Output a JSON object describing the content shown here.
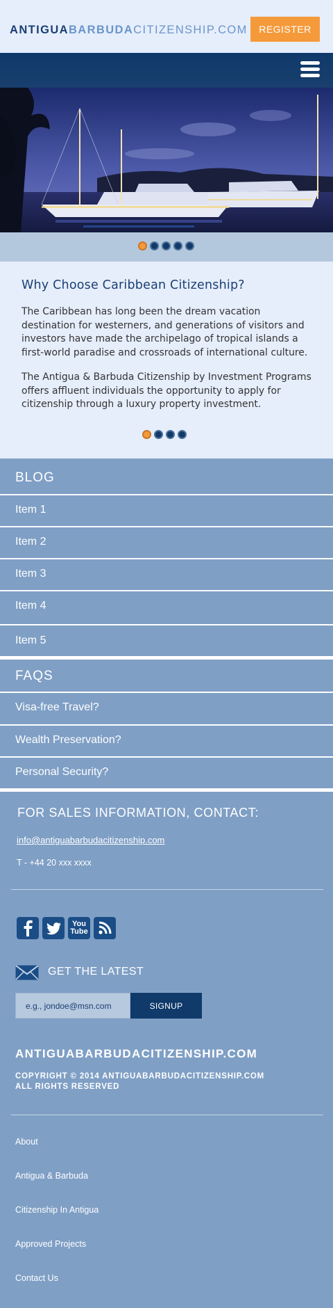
{
  "header": {
    "logo_part1": "ANTIGUA",
    "logo_part2": "BARBUDA",
    "logo_part3": "CITIZENSHIP.COM",
    "register_label": "REGISTER"
  },
  "colors": {
    "header_bg": "#e6eefb",
    "navbar": "#0f3a6a",
    "accent": "#f59a3a",
    "body_bg": "#7f9fc5",
    "heading_blue": "#1b3f73"
  },
  "hero": {
    "image": "superyachts-marina-dusk",
    "slides_count": 5,
    "active_slide": 1
  },
  "intro": {
    "title": "Why Choose Caribbean Citizenship?",
    "paragraph1": "The Caribbean has long been the dream vacation destination for westerners, and generations of visitors and investors have made the archipelago of tropical islands a first-world paradise and crossroads of international culture.",
    "paragraph2": "The Antigua & Barbuda Citizenship by Investment Programs offers affluent individuals the opportunity to apply for citizenship through a luxury property investment.",
    "slides_count": 4,
    "active_slide": 1
  },
  "blog": {
    "title": "BLOG",
    "items": [
      "Item 1",
      "Item 2",
      "Item 3",
      "Item 4",
      "Item 5"
    ]
  },
  "faqs": {
    "title": "FAQS",
    "items": [
      "Visa-free Travel?",
      "Wealth Preservation?",
      "Personal Security?"
    ]
  },
  "contact": {
    "title": "FOR SALES INFORMATION, CONTACT:",
    "email": "info@antiguabarbudacitizenship.com",
    "phone": "T - +44 20 xxx xxxx"
  },
  "social": {
    "icons": [
      "facebook-icon",
      "twitter-icon",
      "youtube-icon",
      "rss-icon"
    ],
    "youtube_top": "You",
    "youtube_bottom": "Tube"
  },
  "newsletter": {
    "label": "GET THE LATEST",
    "placeholder": "e.g., jondoe@msn.com",
    "signup_label": "SIGNUP"
  },
  "footer": {
    "brand": "ANTIGUABARBUDACITIZENSHIP.COM",
    "copyright_line1": "COPYRIGHT © 2014 ANTIGUABARBUDACITIZENSHIP.COM",
    "copyright_line2": "ALL RIGHTS RESERVED",
    "links": [
      "About",
      "Antigua & Barbuda",
      "Citizenship In Antigua",
      "Approved Projects",
      "Contact Us"
    ]
  }
}
